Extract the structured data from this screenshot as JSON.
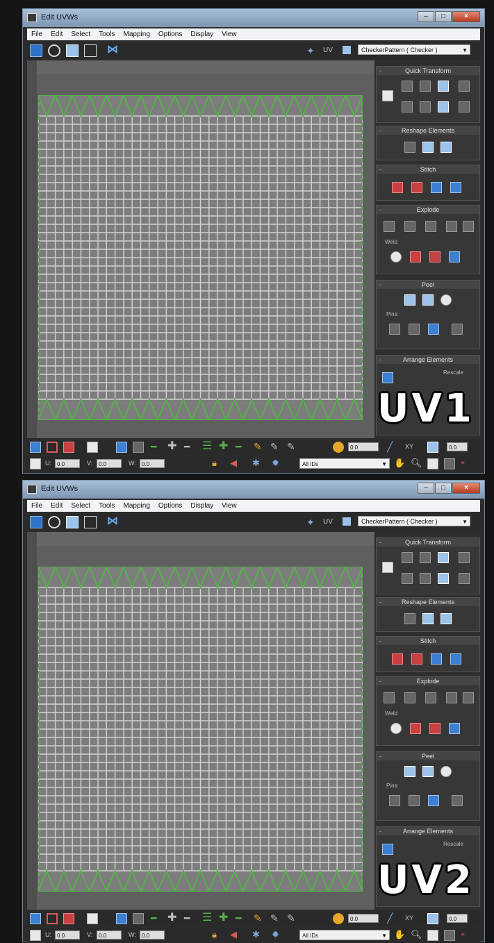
{
  "windows": [
    {
      "title": "Edit UVWs",
      "menu": [
        "File",
        "Edit",
        "Select",
        "Tools",
        "Mapping",
        "Options",
        "Display",
        "View"
      ],
      "uv_label": "UV",
      "texture_dropdown": "CheckerPattern ( Checker )",
      "rollouts": {
        "quick_transform": "Quick Transform",
        "reshape": "Reshape Elements",
        "stitch": "Stitch",
        "explode": "Explode",
        "weld": "Weld",
        "peel": "Peel",
        "pins": "Pins:",
        "arrange": "Arrange Elements",
        "rescale": "Rescale"
      },
      "field_value": "0.0",
      "u_label": "U:",
      "v_label": "V:",
      "w_label": "W:",
      "xy_label": "XY",
      "ids_dropdown": "All IDs",
      "badge": "UV1"
    },
    {
      "title": "Edit UVWs",
      "menu": [
        "File",
        "Edit",
        "Select",
        "Tools",
        "Mapping",
        "Options",
        "Display",
        "View"
      ],
      "uv_label": "UV",
      "texture_dropdown": "CheckerPattern ( Checker )",
      "rollouts": {
        "quick_transform": "Quick Transform",
        "reshape": "Reshape Elements",
        "stitch": "Stitch",
        "explode": "Explode",
        "weld": "Weld",
        "peel": "Peel",
        "pins": "Pins:",
        "arrange": "Arrange Elements",
        "rescale": "Rescale"
      },
      "field_value": "0.0",
      "u_label": "U:",
      "v_label": "V:",
      "w_label": "W:",
      "xy_label": "XY",
      "ids_dropdown": "All IDs",
      "badge": "UV2"
    }
  ],
  "colors": {
    "uv_edge": "#56b04a",
    "grid_line": "#d2d2d2",
    "grid_fill": "#7d7d7d",
    "viewport_bg": "#5f5f5f",
    "title_bar": "#9ab1c9"
  },
  "icons": [
    "move-icon",
    "rotate-icon",
    "scale-icon",
    "freeform-icon",
    "mirror-icon",
    "uv-switch-icon",
    "show-map-icon"
  ]
}
